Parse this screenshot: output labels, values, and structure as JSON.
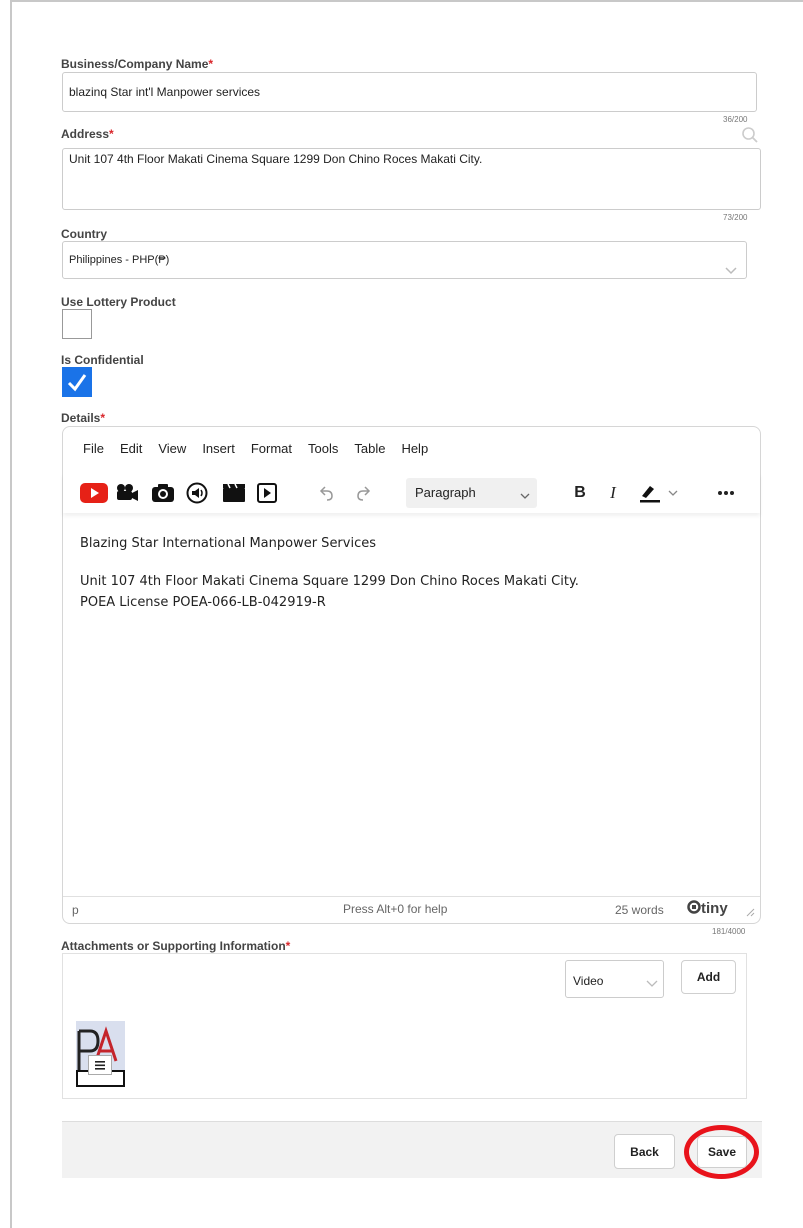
{
  "form": {
    "business_name": {
      "label": "Business/Company Name",
      "required_mark": "*",
      "value": "blazinq Star int'l Manpower services",
      "counter": "36/200"
    },
    "address": {
      "label": "Address",
      "required_mark": "*",
      "value": "Unit 107 4th Floor Makati Cinema Square 1299 Don Chino Roces Makati City.",
      "counter": "73/200"
    },
    "country": {
      "label": "Country",
      "selected": "Philippines - PHP(₱)"
    },
    "use_lottery": {
      "label": "Use Lottery Product",
      "checked": false
    },
    "is_confidential": {
      "label": "Is Confidential",
      "checked": true
    },
    "details": {
      "label": "Details",
      "required_mark": "*",
      "menu": [
        "File",
        "Edit",
        "View",
        "Insert",
        "Format",
        "Tools",
        "Table",
        "Help"
      ],
      "block_format": "Paragraph",
      "toolbar_icons": [
        "youtube-icon",
        "video-camera-icon",
        "camera-icon",
        "audio-icon",
        "clapperboard-icon",
        "media-play-icon",
        "undo-icon",
        "redo-icon",
        "bold-icon",
        "italic-icon",
        "highlight-icon",
        "more-icon"
      ],
      "content": [
        "Blazing Star International Manpower Services",
        "Unit 107 4th Floor Makati Cinema Square 1299 Don Chino Roces Makati City.",
        "POEA License POEA-066-LB-042919-R"
      ],
      "status_path": "p",
      "status_help": "Press Alt+0 for help",
      "word_count": "25 words",
      "brand": "tiny",
      "counter": "181/4000"
    },
    "attachments": {
      "label": "Attachments or Supporting Information",
      "required_mark": "*",
      "type_selected": "Video",
      "add_label": "Add"
    }
  },
  "footer": {
    "back_label": "Back",
    "save_label": "Save"
  },
  "colors": {
    "accent": "#1a73e8",
    "required": "#d9262b",
    "highlight_ring": "#e8131b",
    "youtube": "#e62117"
  }
}
